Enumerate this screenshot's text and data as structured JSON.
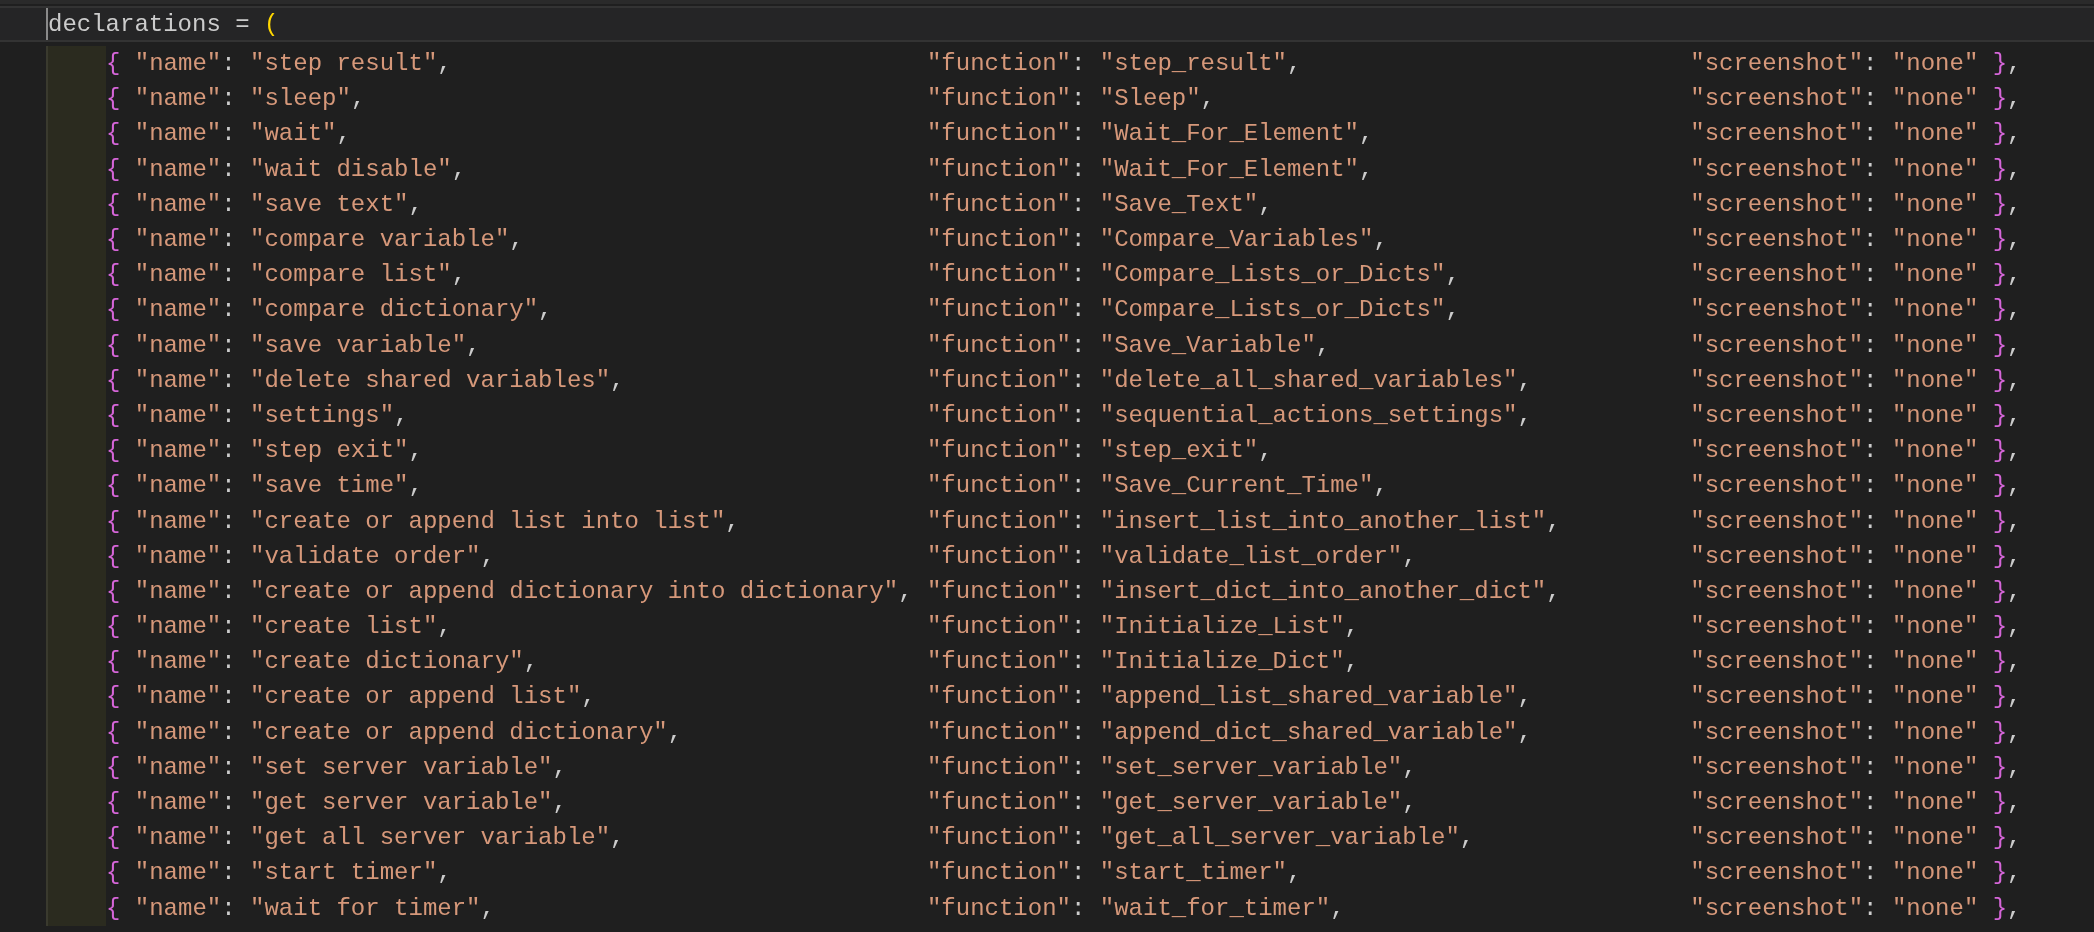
{
  "header": {
    "text": "declarations = (",
    "active": true
  },
  "entries": [
    {
      "name": "{ \"name\": \"step result\",",
      "function": "\"function\": \"step_result\",",
      "screenshot": "\"screenshot\": \"none\" },"
    },
    {
      "name": "{ \"name\": \"sleep\",",
      "function": "\"function\": \"Sleep\",",
      "screenshot": "\"screenshot\": \"none\" },"
    },
    {
      "name": "{ \"name\": \"wait\",",
      "function": "\"function\": \"Wait_For_Element\",",
      "screenshot": "\"screenshot\": \"none\" },"
    },
    {
      "name": "{ \"name\": \"wait disable\",",
      "function": "\"function\": \"Wait_For_Element\",",
      "screenshot": "\"screenshot\": \"none\" },"
    },
    {
      "name": "{ \"name\": \"save text\",",
      "function": "\"function\": \"Save_Text\",",
      "screenshot": "\"screenshot\": \"none\" },"
    },
    {
      "name": "{ \"name\": \"compare variable\",",
      "function": "\"function\": \"Compare_Variables\",",
      "screenshot": "\"screenshot\": \"none\" },"
    },
    {
      "name": "{ \"name\": \"compare list\",",
      "function": "\"function\": \"Compare_Lists_or_Dicts\",",
      "screenshot": "\"screenshot\": \"none\" },"
    },
    {
      "name": "{ \"name\": \"compare dictionary\",",
      "function": "\"function\": \"Compare_Lists_or_Dicts\",",
      "screenshot": "\"screenshot\": \"none\" },"
    },
    {
      "name": "{ \"name\": \"save variable\",",
      "function": "\"function\": \"Save_Variable\",",
      "screenshot": "\"screenshot\": \"none\" },"
    },
    {
      "name": "{ \"name\": \"delete shared variables\",",
      "function": "\"function\": \"delete_all_shared_variables\",",
      "screenshot": "\"screenshot\": \"none\" },"
    },
    {
      "name": "{ \"name\": \"settings\",",
      "function": "\"function\": \"sequential_actions_settings\",",
      "screenshot": "\"screenshot\": \"none\" },"
    },
    {
      "name": "{ \"name\": \"step exit\",",
      "function": "\"function\": \"step_exit\",",
      "screenshot": "\"screenshot\": \"none\" },"
    },
    {
      "name": "{ \"name\": \"save time\",",
      "function": "\"function\": \"Save_Current_Time\",",
      "screenshot": "\"screenshot\": \"none\" },"
    },
    {
      "name": "{ \"name\": \"create or append list into list\",",
      "function": "\"function\": \"insert_list_into_another_list\",",
      "screenshot": "\"screenshot\": \"none\" },"
    },
    {
      "name": "{ \"name\": \"validate order\",",
      "function": "\"function\": \"validate_list_order\",",
      "screenshot": "\"screenshot\": \"none\" },"
    },
    {
      "name": "{ \"name\": \"create or append dictionary into dictionary\",",
      "function": "\"function\": \"insert_dict_into_another_dict\",",
      "screenshot": "\"screenshot\": \"none\" },"
    },
    {
      "name": "{ \"name\": \"create list\",",
      "function": "\"function\": \"Initialize_List\",",
      "screenshot": "\"screenshot\": \"none\" },"
    },
    {
      "name": "{ \"name\": \"create dictionary\",",
      "function": "\"function\": \"Initialize_Dict\",",
      "screenshot": "\"screenshot\": \"none\" },"
    },
    {
      "name": "{ \"name\": \"create or append list\",",
      "function": "\"function\": \"append_list_shared_variable\",",
      "screenshot": "\"screenshot\": \"none\" },"
    },
    {
      "name": "{ \"name\": \"create or append dictionary\",",
      "function": "\"function\": \"append_dict_shared_variable\",",
      "screenshot": "\"screenshot\": \"none\" },"
    },
    {
      "name": "{ \"name\": \"set server variable\",",
      "function": "\"function\": \"set_server_variable\",",
      "screenshot": "\"screenshot\": \"none\" },"
    },
    {
      "name": "{ \"name\": \"get server variable\",",
      "function": "\"function\": \"get_server_variable\",",
      "screenshot": "\"screenshot\": \"none\" },"
    },
    {
      "name": "{ \"name\": \"get all server variable\",",
      "function": "\"function\": \"get_all_server_variable\",",
      "screenshot": "\"screenshot\": \"none\" },"
    },
    {
      "name": "{ \"name\": \"start timer\",",
      "function": "\"function\": \"start_timer\",",
      "screenshot": "\"screenshot\": \"none\" },"
    },
    {
      "name": "{ \"name\": \"wait for timer\",",
      "function": "\"function\": \"wait_for_timer\",",
      "screenshot": "\"screenshot\": \"none\" },"
    }
  ]
}
